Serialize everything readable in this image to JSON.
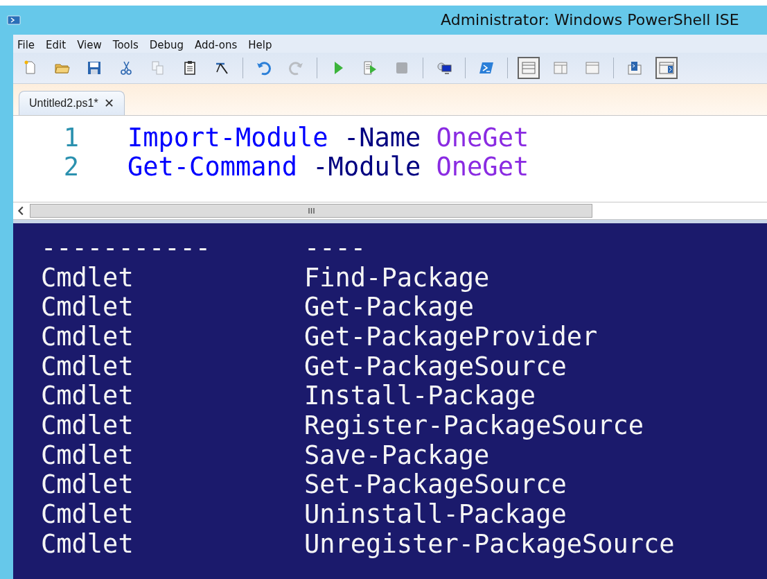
{
  "window": {
    "title": "Administrator: Windows PowerShell ISE"
  },
  "menu": [
    "File",
    "Edit",
    "View",
    "Tools",
    "Debug",
    "Add-ons",
    "Help"
  ],
  "toolbar": [
    {
      "kind": "new",
      "disabled": false,
      "selected": false
    },
    {
      "kind": "open",
      "disabled": false,
      "selected": false
    },
    {
      "kind": "save",
      "disabled": false,
      "selected": false
    },
    {
      "kind": "cut",
      "disabled": false,
      "selected": false
    },
    {
      "kind": "copy",
      "disabled": true,
      "selected": false
    },
    {
      "kind": "paste",
      "disabled": false,
      "selected": false
    },
    {
      "kind": "clear",
      "disabled": false,
      "selected": false
    },
    {
      "kind": "separator"
    },
    {
      "kind": "undo",
      "disabled": false,
      "selected": false
    },
    {
      "kind": "redo",
      "disabled": true,
      "selected": false
    },
    {
      "kind": "separator"
    },
    {
      "kind": "run",
      "disabled": false,
      "selected": false
    },
    {
      "kind": "run-selection",
      "disabled": false,
      "selected": false
    },
    {
      "kind": "stop",
      "disabled": true,
      "selected": false
    },
    {
      "kind": "separator"
    },
    {
      "kind": "remote",
      "disabled": false,
      "selected": false
    },
    {
      "kind": "separator"
    },
    {
      "kind": "powershell",
      "disabled": false,
      "selected": false
    },
    {
      "kind": "separator"
    },
    {
      "kind": "layout-top",
      "disabled": false,
      "selected": true
    },
    {
      "kind": "layout-right",
      "disabled": false,
      "selected": false
    },
    {
      "kind": "layout-max",
      "disabled": false,
      "selected": false
    },
    {
      "kind": "separator"
    },
    {
      "kind": "script-pane",
      "disabled": false,
      "selected": false
    },
    {
      "kind": "command-pane",
      "disabled": false,
      "selected": true
    }
  ],
  "tabs": [
    {
      "label": "Untitled2.ps1*",
      "close": "✕",
      "selected": true
    }
  ],
  "editor": {
    "lines": [
      {
        "number": "1",
        "tokens": [
          {
            "kind": "command",
            "text": "Import-Module"
          },
          {
            "kind": "parameter",
            "text": "-Name"
          },
          {
            "kind": "argument",
            "text": "OneGet"
          }
        ]
      },
      {
        "number": "2",
        "tokens": [
          {
            "kind": "command",
            "text": "Get-Command"
          },
          {
            "kind": "parameter",
            "text": "-Module"
          },
          {
            "kind": "argument",
            "text": "OneGet"
          }
        ]
      }
    ]
  },
  "console": {
    "rows": [
      [
        "-----------",
        "----"
      ],
      [
        "Cmdlet",
        "Find-Package"
      ],
      [
        "Cmdlet",
        "Get-Package"
      ],
      [
        "Cmdlet",
        "Get-PackageProvider"
      ],
      [
        "Cmdlet",
        "Get-PackageSource"
      ],
      [
        "Cmdlet",
        "Install-Package"
      ],
      [
        "Cmdlet",
        "Register-PackageSource"
      ],
      [
        "Cmdlet",
        "Save-Package"
      ],
      [
        "Cmdlet",
        "Set-PackageSource"
      ],
      [
        "Cmdlet",
        "Uninstall-Package"
      ],
      [
        "Cmdlet",
        "Unregister-PackageSource"
      ]
    ]
  }
}
